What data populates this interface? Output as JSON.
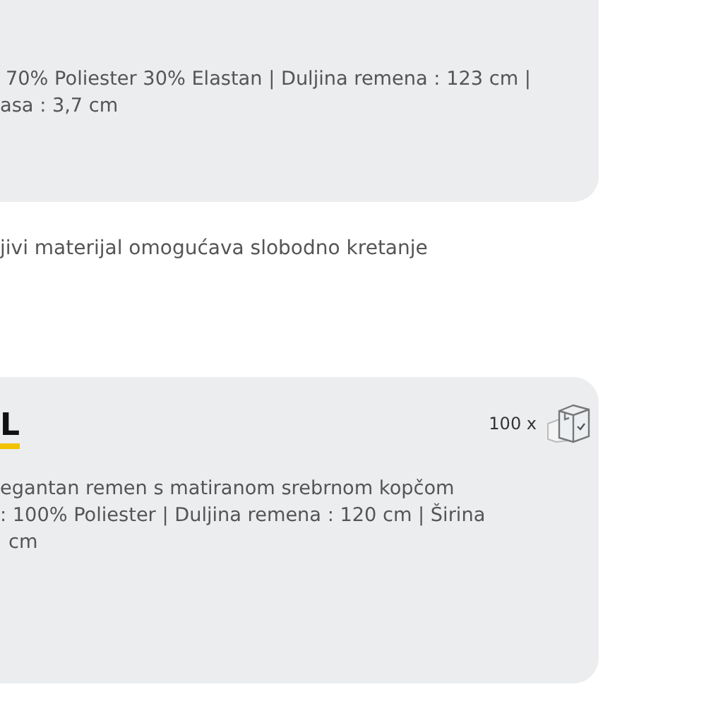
{
  "cards": [
    {
      "details": [
        "70% Poliester 30% Elastan | Duljina remena : 123 cm |",
        "asa : 3,7 cm"
      ]
    },
    {
      "title": "L",
      "quantity": "100 x",
      "details": [
        "egantan remen s matiranom srebrnom kopčom",
        ": 100% Poliester | Duljina remena : 120 cm | Širina",
        "cm"
      ]
    }
  ],
  "feature_text": "jivi materijal omogućava slobodno kretanje"
}
